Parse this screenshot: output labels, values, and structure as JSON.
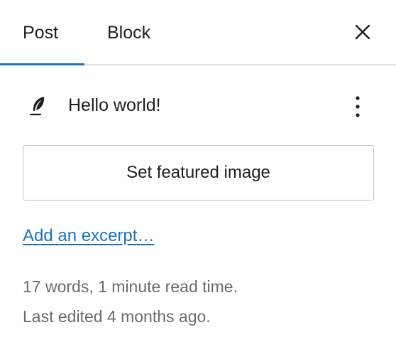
{
  "tabs": {
    "post_label": "Post",
    "block_label": "Block",
    "active": "post"
  },
  "header": {
    "close_icon": "close-icon"
  },
  "post": {
    "icon": "feather-icon",
    "title": "Hello world!",
    "more_icon": "vertical-ellipsis-icon"
  },
  "featured_image": {
    "button_label": "Set featured image"
  },
  "excerpt": {
    "link_label": "Add an excerpt…"
  },
  "meta": {
    "word_count_text": "17 words, 1 minute read time.",
    "last_edited_text": "Last edited 4 months ago."
  },
  "colors": {
    "accent": "#2271b1",
    "link": "#1a73ba",
    "text": "#1e1e1e",
    "muted": "#6b6b6b",
    "border": "#c3c4c7",
    "divider": "#e0e0e0"
  }
}
